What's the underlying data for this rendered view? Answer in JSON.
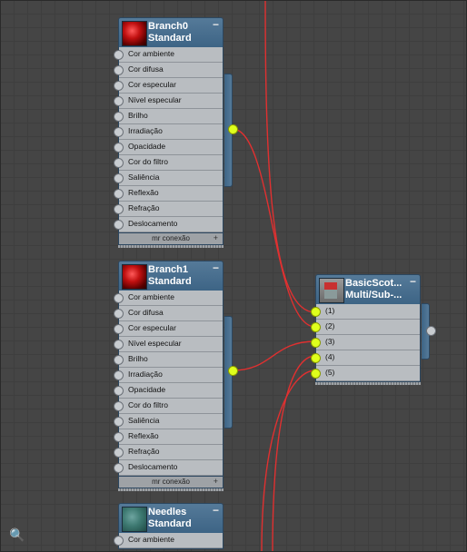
{
  "nodes": {
    "branch0": {
      "name": "Branch0",
      "type": "Standard",
      "slots": [
        "Cor ambiente",
        "Cor difusa",
        "Cor especular",
        "Nível especular",
        "Brilho",
        "Irradiação",
        "Opacidade",
        "Cor do filtro",
        "Saliência",
        "Reflexão",
        "Refração",
        "Deslocamento"
      ],
      "footer": "mr conexão"
    },
    "branch1": {
      "name": "Branch1",
      "type": "Standard",
      "slots": [
        "Cor ambiente",
        "Cor difusa",
        "Cor especular",
        "Nível especular",
        "Brilho",
        "Irradiação",
        "Opacidade",
        "Cor do filtro",
        "Saliência",
        "Reflexão",
        "Refração",
        "Deslocamento"
      ],
      "footer": "mr conexão"
    },
    "needles": {
      "name": "Needles",
      "type": "Standard",
      "slots": [
        "Cor ambiente"
      ]
    },
    "basic": {
      "name": "BasicScot...",
      "type": "Multi/Sub-...",
      "slots": [
        "(1)",
        "(2)",
        "(3)",
        "(4)",
        "(5)"
      ]
    }
  },
  "icons": {
    "minimize": "−",
    "plus": "+",
    "binoculars": "🔍"
  },
  "colors": {
    "wire": "#e03030",
    "port_connected": "#dfff1c",
    "header": "#4a6f90"
  }
}
